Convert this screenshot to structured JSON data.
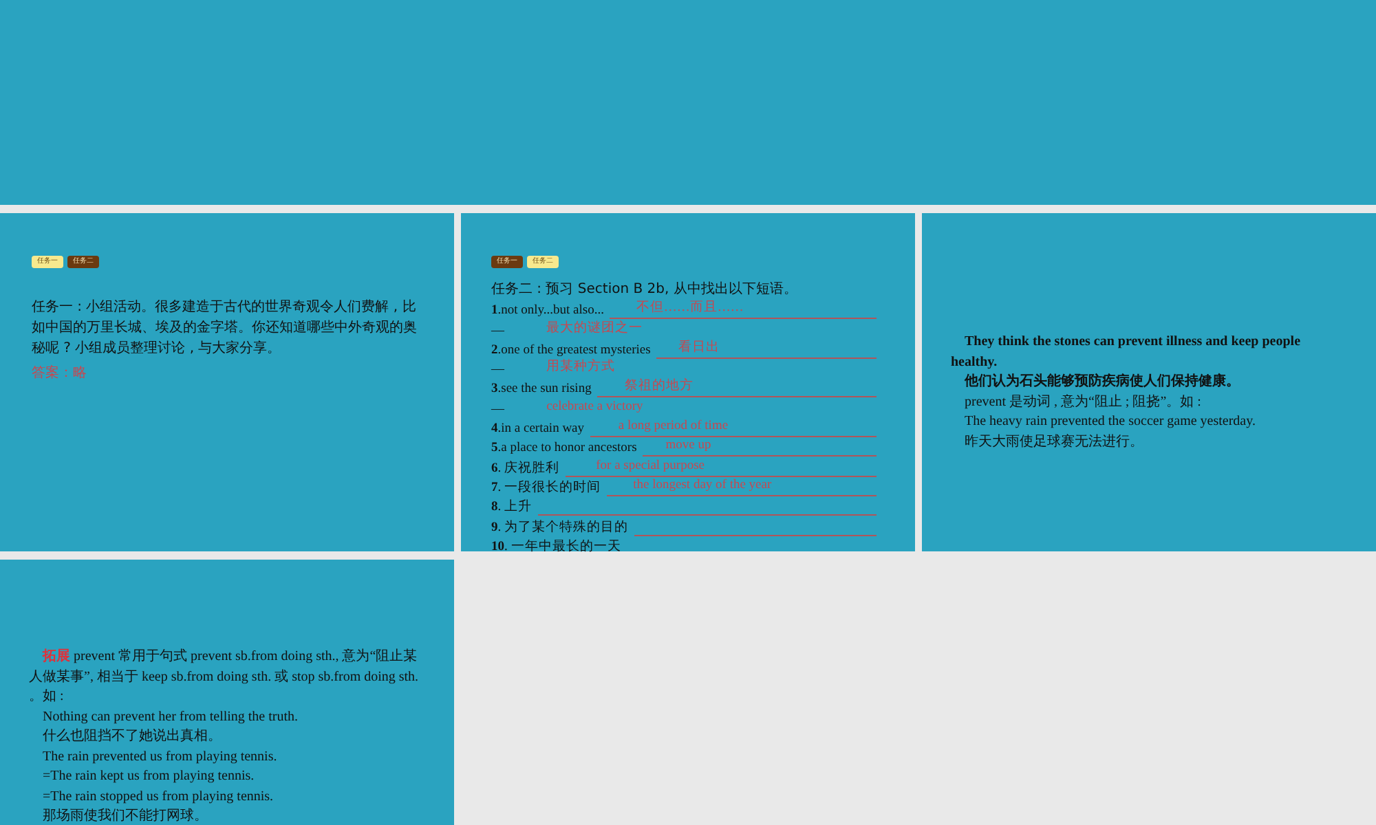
{
  "slides": [
    {
      "kind": "blank"
    },
    {
      "kind": "task",
      "tabs": [
        {
          "label": "任务一",
          "selected": true
        },
        {
          "label": "任务二",
          "selected": false
        }
      ],
      "title": "任务一 : 小组活动。很多建造于古代的世界奇观令人们费解 , 比如中国的万里长城、埃及的金字塔。你还知道哪些中外奇观的奥秘呢 ? 小组成员整理讨论 , 与大家分享。",
      "answer": "答案：略"
    },
    {
      "kind": "exercise",
      "tabs": [
        {
          "label": "任务一",
          "selected": false
        },
        {
          "label": "任务二",
          "selected": true
        }
      ],
      "title": "任务二 : 预习 Section B 2b, 从中找出以下短语。",
      "rows": [
        {
          "prompt": "**1**.not only...but also...",
          "answer": "不但……而且……",
          "blank": true
        },
        {
          "prompt": "—",
          "answer": "最大的谜团之一",
          "blank": false
        },
        {
          "prompt": "**2**.one of the greatest mysteries",
          "answer": "看日出",
          "blank": true
        },
        {
          "prompt": "—",
          "answer": "用某种方式",
          "blank": false
        },
        {
          "prompt": "**3**.see the sun rising",
          "answer": "祭祖的地方",
          "blank": true
        },
        {
          "prompt": "—",
          "answer": "celebrate a victory",
          "blank": false
        },
        {
          "prompt": "**4**.in a certain way",
          "answer": "a long period of time",
          "blank": true
        },
        {
          "prompt": "**5**.a place to honor ancestors",
          "answer": "move up",
          "blank": true
        },
        {
          "prompt": "**6**. 庆祝胜利",
          "answer": "for a special purpose",
          "blank": true
        },
        {
          "prompt": "**7**. 一段很长的时间",
          "answer": "the longest day of the year",
          "blank": true
        },
        {
          "prompt": "**8**. 上升",
          "blank": true
        },
        {
          "prompt": "**9**. 为了某个特殊的目的",
          "blank": true
        },
        {
          "prompt": "**10**. 一年中最长的一天",
          "blank": false
        }
      ]
    },
    {
      "kind": "notes",
      "lines": [
        {
          "text": "They think the stones can prevent illness and keep people healthy.",
          "bold": true
        },
        {
          "text": "他们认为石头能够预防疾病使人们保持健康。",
          "bold": true
        },
        {
          "text": "prevent 是动词 , 意为“阻止 ; 阻挠”。如 :",
          "bold": false
        },
        {
          "text": "The heavy rain prevented the soccer game yesterday.",
          "bold": false
        },
        {
          "text": "昨天大雨使足球赛无法进行。",
          "bold": false
        }
      ]
    },
    {
      "kind": "expansion",
      "label": "拓展",
      "lines": [
        "prevent 常用于句式 prevent sb.from doing sth., 意为“阻止某人做某事”, 相当于 keep sb.from doing sth. 或 stop sb.from doing sth. 。如 :",
        "Nothing can prevent her from telling the truth.",
        "什么也阻挡不了她说出真相。",
        "The rain prevented us from playing tennis.",
        "=The rain kept us from playing tennis.",
        "=The rain stopped us from playing tennis.",
        "那场雨使我们不能打网球。"
      ]
    }
  ]
}
